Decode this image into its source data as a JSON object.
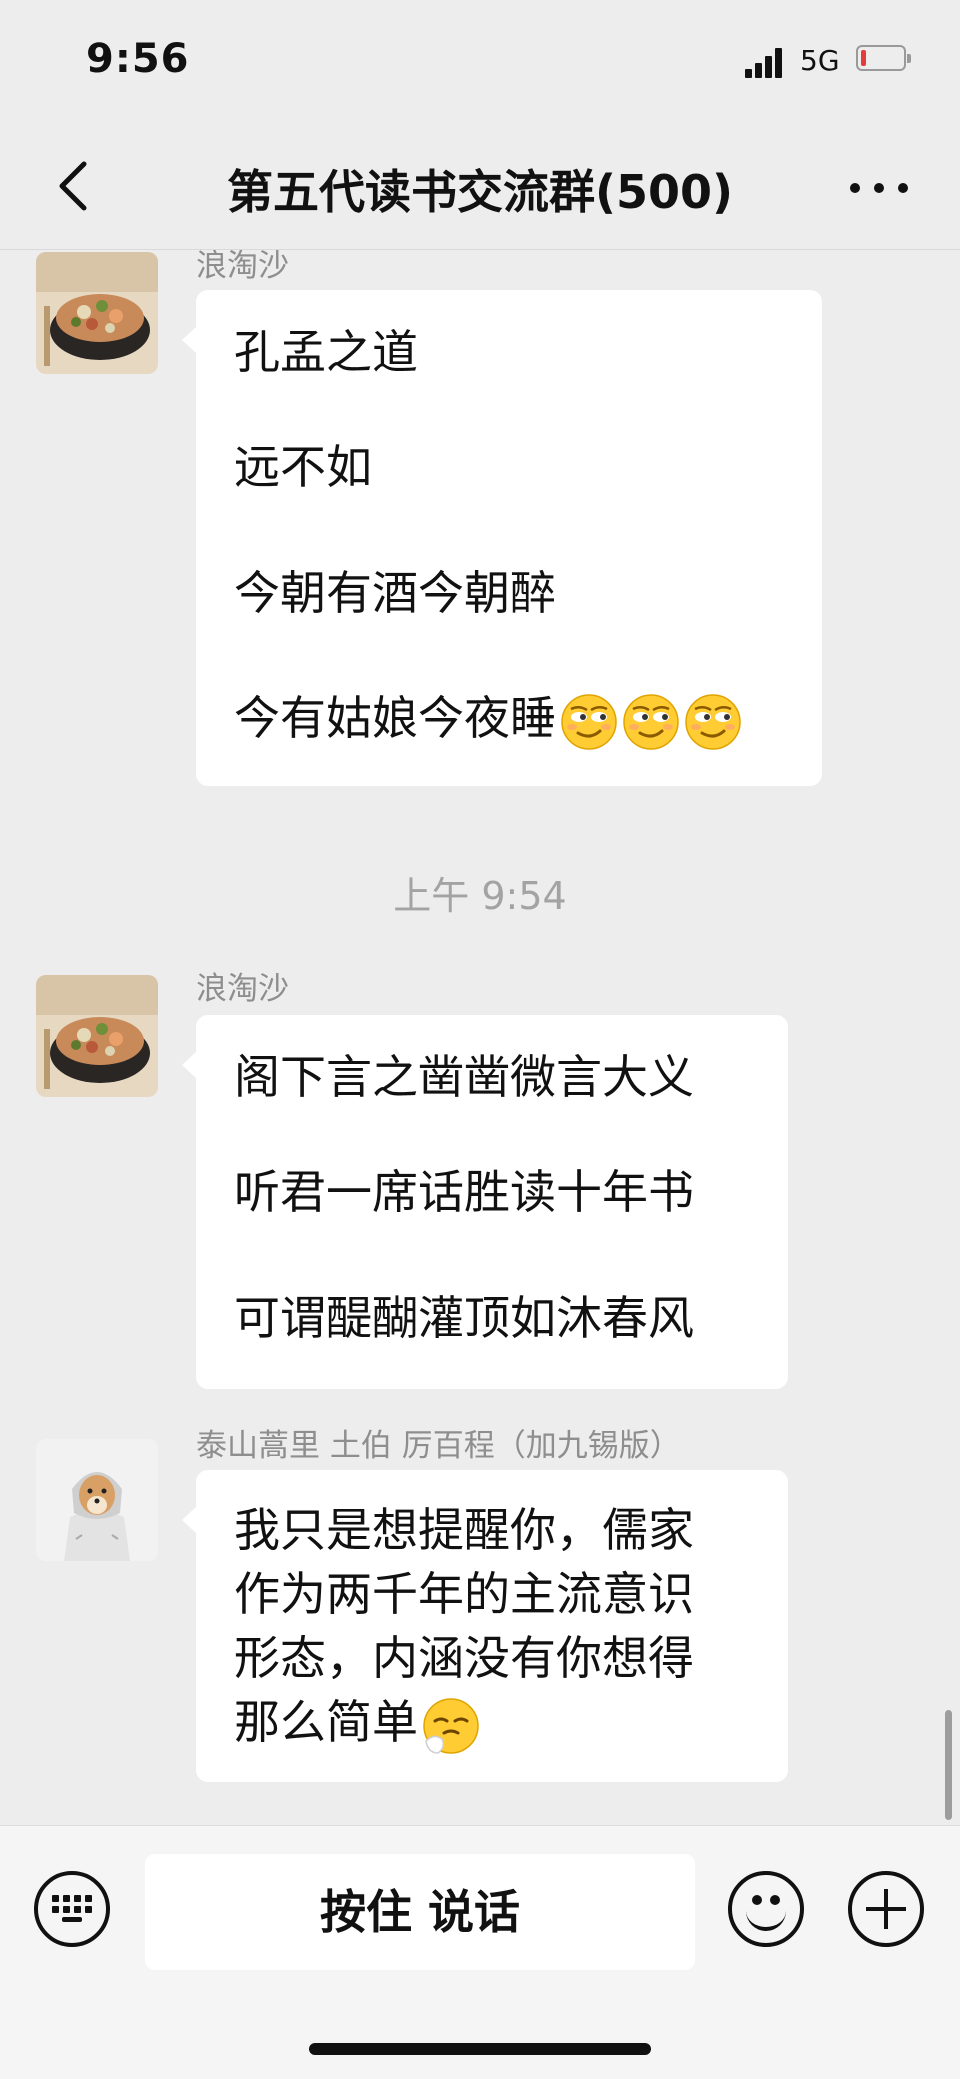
{
  "status_bar": {
    "time": "9:56",
    "network": "5G",
    "battery_level": 0.08,
    "signal_bars": 4
  },
  "header": {
    "title": "第五代读书交流群(500)",
    "back_icon": "chevron-left-icon",
    "more_icon": "more-dots-icon"
  },
  "messages": [
    {
      "sender": "浪淘沙",
      "avatar": "food-bowl-avatar",
      "lines": [
        "孔孟之道",
        "远不如",
        "今朝有酒今朝醉",
        "今有姑娘今夜睡"
      ],
      "trailing_emoji": [
        "smirk-emoji",
        "smirk-emoji",
        "smirk-emoji"
      ]
    },
    {
      "timestamp": "上午 9:54"
    },
    {
      "sender": "浪淘沙",
      "avatar": "food-bowl-avatar",
      "lines": [
        "阁下言之凿凿微言大义",
        "听君一席话胜读十年书",
        "可谓醍醐灌顶如沐春风"
      ]
    },
    {
      "sender": "泰山蒿里 土伯 厉百程（加九锡版）",
      "avatar": "shiba-dog-hoodie-avatar",
      "lines": [
        "我只是想提醒你，儒家",
        "作为两千年的主流意识",
        "形态，内涵没有你想得",
        "那么简单"
      ],
      "trailing_emoji": [
        "sneeze-emoji"
      ]
    }
  ],
  "input_bar": {
    "keyboard_icon": "keyboard-icon",
    "hold_to_talk_label": "按住 说话",
    "emoji_icon": "smiley-icon",
    "plus_icon": "plus-icon"
  },
  "colors": {
    "background": "#ededed",
    "bubble": "#ffffff",
    "meta_text": "#8e8e8e",
    "timestamp_text": "#a3a3a3"
  }
}
